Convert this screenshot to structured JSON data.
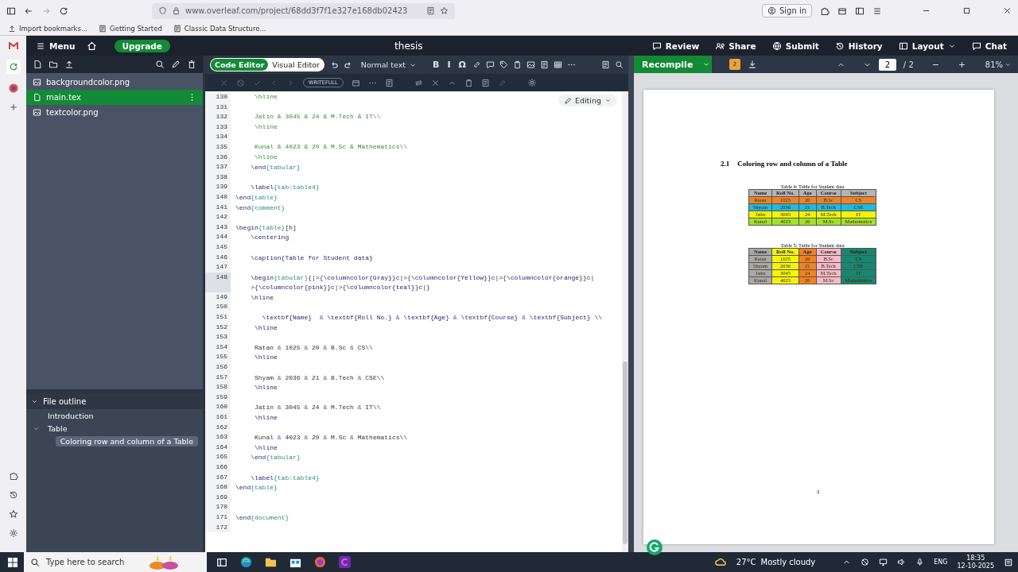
{
  "browser": {
    "url": "www.overleaf.com/project/68dd3f7f1e327e168db02423",
    "sign_in": "Sign in",
    "bookmarks": [
      "Import bookmarks...",
      "Getting Started",
      "Classic Data Structure..."
    ]
  },
  "header": {
    "menu": "Menu",
    "upgrade": "Upgrade",
    "title": "thesis",
    "actions": [
      "Review",
      "Share",
      "Submit",
      "History",
      "Layout",
      "Chat"
    ]
  },
  "file_tree": {
    "files": [
      {
        "name": "backgroundcolor.png",
        "kind": "image",
        "selected": false
      },
      {
        "name": "main.tex",
        "kind": "tex",
        "selected": true
      },
      {
        "name": "textcolor.png",
        "kind": "image",
        "selected": false
      }
    ]
  },
  "outline": {
    "title": "File outline",
    "expanded": true,
    "items": [
      {
        "label": "Introduction",
        "selected": false
      },
      {
        "label": "Table",
        "selected": false,
        "expanded": true,
        "children": [
          {
            "label": "Coloring row and column of a Table",
            "selected": true
          }
        ]
      }
    ]
  },
  "editor": {
    "modes": [
      {
        "label": "Code Editor",
        "selected": true
      },
      {
        "label": "Visual Editor",
        "selected": false
      }
    ],
    "style": "Normal text",
    "format_buttons": [
      "B",
      "I",
      "Ω"
    ],
    "writefull": "WRITEFULL",
    "mode_menu": "Editing",
    "lines": [
      {
        "num": "130",
        "kind": "comment",
        "active": false,
        "text": "     \\hline"
      },
      {
        "num": "131",
        "active": false
      },
      {
        "num": "132",
        "kind": "comment",
        "active": false,
        "text": "     Jatin & 3045 & 24 & M.Tech & IT\\\\"
      },
      {
        "num": "133",
        "kind": "comment",
        "active": false,
        "text": "     \\hline"
      },
      {
        "num": "134",
        "active": false
      },
      {
        "num": "135",
        "kind": "comment",
        "active": false,
        "text": "     Kunal & 4023 & 20 & M.Sc & Mathematics\\\\"
      },
      {
        "num": "136",
        "kind": "comment",
        "active": false,
        "text": "     \\hline"
      },
      {
        "num": "137",
        "kind": "code",
        "active": false,
        "text": "    \\end{tabular}"
      },
      {
        "num": "138",
        "active": false
      },
      {
        "num": "139",
        "kind": "code",
        "active": false,
        "text": "    \\label{tab:table4}"
      },
      {
        "num": "140",
        "kind": "code",
        "active": false,
        "text": "\\end{table}"
      },
      {
        "num": "141",
        "kind": "code",
        "active": false,
        "text": "\\end{comment}"
      },
      {
        "num": "142",
        "active": false
      },
      {
        "num": "143",
        "kind": "code",
        "active": false,
        "text": "\\begin{table}[h]"
      },
      {
        "num": "144",
        "kind": "code",
        "active": false,
        "text": "    \\centering"
      },
      {
        "num": "145",
        "active": false
      },
      {
        "num": "146",
        "kind": "code",
        "active": false,
        "text": "    \\caption{Table for Student data}"
      },
      {
        "num": "147",
        "active": false
      },
      {
        "num": "148",
        "kind": "code",
        "active": true,
        "text": "    \\begin{tabular}{|>{\\columncolor{Gray}}c|>{\\columncolor{Yellow}}c|>{\\columncolor{orange}}c|",
        "continuation": "    >{\\columncolor{pink}}c|>{\\columncolor{teal}}c|}"
      },
      {
        "num": "149",
        "kind": "code",
        "active": false,
        "text": "    \\hline"
      },
      {
        "num": "150",
        "active": false
      },
      {
        "num": "151",
        "kind": "code",
        "active": false,
        "text": "       \\textbf{Name}  & \\textbf{Roll No.} & \\textbf{Age} & \\textbf{Course} & \\textbf{Subject} \\\\"
      },
      {
        "num": "152",
        "kind": "code",
        "active": false,
        "text": "     \\hline"
      },
      {
        "num": "153",
        "active": false
      },
      {
        "num": "154",
        "kind": "code",
        "active": false,
        "text": "     Ratan & 1025 & 20 & B.Sc & CS\\\\"
      },
      {
        "num": "155",
        "kind": "code",
        "active": false,
        "text": "     \\hline"
      },
      {
        "num": "156",
        "active": false
      },
      {
        "num": "157",
        "kind": "code",
        "active": false,
        "text": "     Shyam & 2036 & 21 & B.Tech & CSE\\\\"
      },
      {
        "num": "158",
        "kind": "code",
        "active": false,
        "text": "     \\hline"
      },
      {
        "num": "159",
        "active": false
      },
      {
        "num": "160",
        "kind": "code",
        "active": false,
        "text": "     Jatin & 3045 & 24 & M.Tech & IT\\\\"
      },
      {
        "num": "161",
        "kind": "code",
        "active": false,
        "text": "     \\hline"
      },
      {
        "num": "162",
        "active": false
      },
      {
        "num": "163",
        "kind": "code",
        "active": false,
        "text": "     Kunal & 4023 & 20 & M.Sc & Mathematics\\\\"
      },
      {
        "num": "164",
        "kind": "code",
        "active": false,
        "text": "     \\hline"
      },
      {
        "num": "165",
        "kind": "code",
        "active": false,
        "text": "    \\end{tabular}"
      },
      {
        "num": "166",
        "active": false
      },
      {
        "num": "167",
        "kind": "code",
        "active": false,
        "text": "    \\label{tab:table4}"
      },
      {
        "num": "168",
        "kind": "code",
        "active": false,
        "text": "\\end{table}"
      },
      {
        "num": "169",
        "active": false
      },
      {
        "num": "170",
        "active": false
      },
      {
        "num": "171",
        "kind": "code",
        "active": false,
        "text": "\\end{document}"
      },
      {
        "num": "172",
        "active": false
      }
    ]
  },
  "pdf": {
    "recompile": "Recompile",
    "log_count": "2",
    "page": "2",
    "page_total": "/ 2",
    "zoom": "81%",
    "section_number": "2.1",
    "section_title": "Coloring row and column of a Table",
    "page_number": "2",
    "tables": [
      {
        "caption": "Table 4: Table for Student data",
        "columns": [
          {
            "label": "Name",
            "color": "#b4b4b4"
          },
          {
            "label": "Roll No.",
            "color": "#b4b4b4"
          },
          {
            "label": "Age",
            "color": "#b4b4b4"
          },
          {
            "label": "Course",
            "color": "#b4b4b4"
          },
          {
            "label": "Subject",
            "color": "#b4b4b4"
          }
        ],
        "rows": [
          {
            "cells": [
              "Ratan",
              "1025",
              "20",
              "B.Sc",
              "CS"
            ],
            "color": "#f08224"
          },
          {
            "cells": [
              "Shyam",
              "2036",
              "21",
              "B.Tech",
              "CSE"
            ],
            "color": "#22b8e0"
          },
          {
            "cells": [
              "Jatin",
              "3045",
              "24",
              "M.Tech",
              "IT"
            ],
            "color": "#f2f20a"
          },
          {
            "cells": [
              "Kunal",
              "4023",
              "20",
              "M.Sc",
              "Mathematics"
            ],
            "color": "#a2e22a"
          }
        ]
      },
      {
        "caption": "Table 5: Table for Student data",
        "columns": [
          {
            "label": "Name",
            "color": "#a9a9a9"
          },
          {
            "label": "Roll No.",
            "color": "#f4f40c"
          },
          {
            "label": "Age",
            "color": "#f08224"
          },
          {
            "label": "Course",
            "color": "#f6b9c9"
          },
          {
            "label": "Subject",
            "color": "#17876f"
          }
        ],
        "rows": [
          {
            "cells": [
              "Ratan",
              "1025",
              "20",
              "B.Sc",
              "CS"
            ]
          },
          {
            "cells": [
              "Shyam",
              "2036",
              "21",
              "B.Tech",
              "CSE"
            ]
          },
          {
            "cells": [
              "Jatin",
              "3045",
              "24",
              "M.Tech",
              "IT"
            ]
          },
          {
            "cells": [
              "Kunal",
              "4023",
              "20",
              "M.Sc",
              "Mathematics"
            ]
          }
        ]
      }
    ]
  },
  "taskbar": {
    "search_placeholder": "Type here to search",
    "temperature": "27°C",
    "weather": "Mostly cloudy",
    "language": "ENG",
    "time": "18:35",
    "date": "12-10-2025"
  }
}
